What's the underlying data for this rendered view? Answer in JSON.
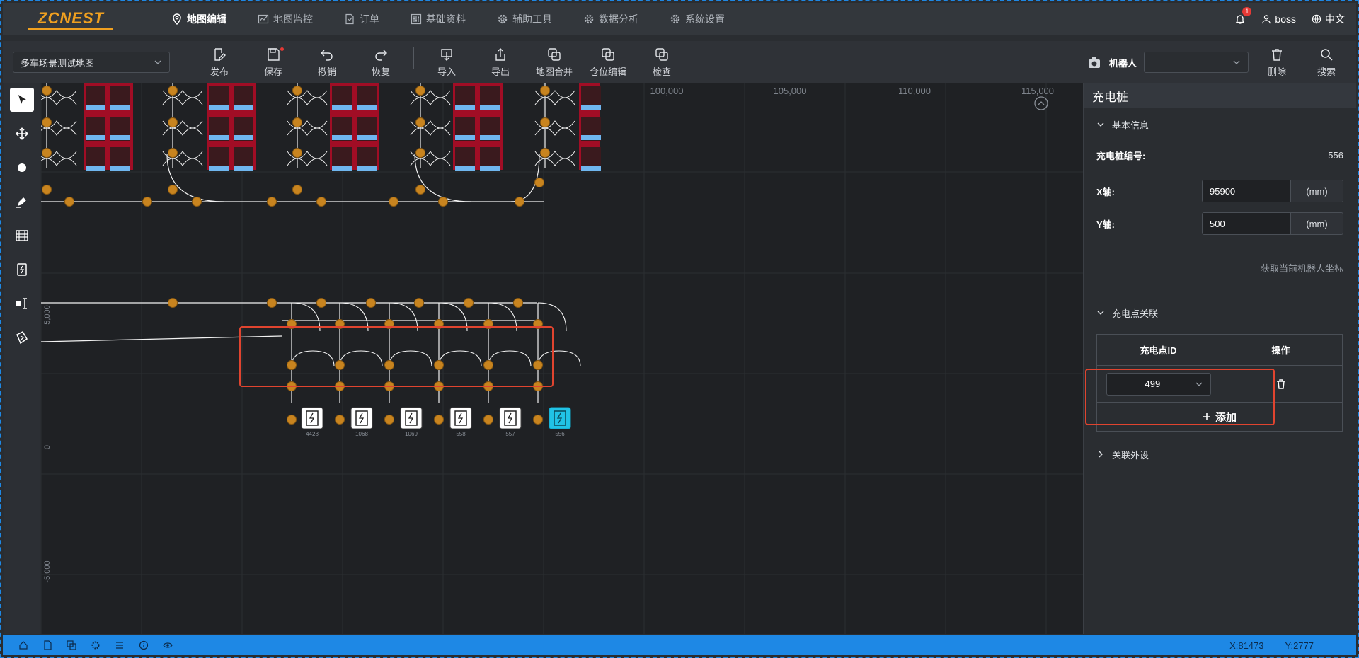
{
  "app": {
    "logo": "ZCNEST"
  },
  "nav": {
    "items": [
      {
        "label": "地图编辑",
        "icon": "location-pin-icon",
        "active": true
      },
      {
        "label": "地图监控",
        "icon": "chart-icon",
        "active": false
      },
      {
        "label": "订单",
        "icon": "document-icon",
        "active": false
      },
      {
        "label": "基础资料",
        "icon": "sliders-icon",
        "active": false
      },
      {
        "label": "辅助工具",
        "icon": "gear-icon",
        "active": false
      },
      {
        "label": "数据分析",
        "icon": "gear-icon",
        "active": false
      },
      {
        "label": "系统设置",
        "icon": "gear-icon",
        "active": false
      }
    ],
    "notification_count": "1",
    "user": "boss",
    "language": "中文"
  },
  "toolbar": {
    "map_name": "多车场景测试地图",
    "tools": [
      {
        "label": "发布",
        "icon": "publish-icon"
      },
      {
        "label": "保存",
        "icon": "save-icon"
      },
      {
        "label": "撤销",
        "icon": "undo-icon"
      },
      {
        "label": "恢复",
        "icon": "redo-icon"
      },
      {
        "label": "导入",
        "icon": "import-icon"
      },
      {
        "label": "导出",
        "icon": "export-icon"
      },
      {
        "label": "地图合并",
        "icon": "merge-icon"
      },
      {
        "label": "仓位编辑",
        "icon": "merge-icon"
      },
      {
        "label": "检查",
        "icon": "merge-icon"
      }
    ],
    "robot_label": "机器人",
    "robot_value": "",
    "delete_label": "删除",
    "search_label": "搜索"
  },
  "canvas": {
    "x_ticks": [
      "100,000",
      "105,000",
      "110,000",
      "115,000"
    ],
    "y_ticks": [
      "5,000",
      "0",
      "-5,000"
    ],
    "chargers": [
      "4428",
      "1068",
      "1069",
      "558",
      "557",
      "556"
    ]
  },
  "panel": {
    "title": "充电桩",
    "basic_section": "基本信息",
    "id_label": "充电桩编号:",
    "id_value": "556",
    "x_label": "X轴:",
    "x_value": "95900",
    "y_label": "Y轴:",
    "y_value": "500",
    "unit": "(mm)",
    "get_coords_link": "获取当前机器人坐标",
    "link_section": "充电点关联",
    "col_id": "充电点ID",
    "col_op": "操作",
    "point_id": "499",
    "add_label": "添加",
    "peripheral_section": "关联外设"
  },
  "status": {
    "x": "X:81473",
    "y": "Y:2777"
  },
  "colors": {
    "accent": "#1e88e5",
    "highlight": "#e0442f",
    "node": "#c8841f",
    "shelf": "#b0102a"
  }
}
